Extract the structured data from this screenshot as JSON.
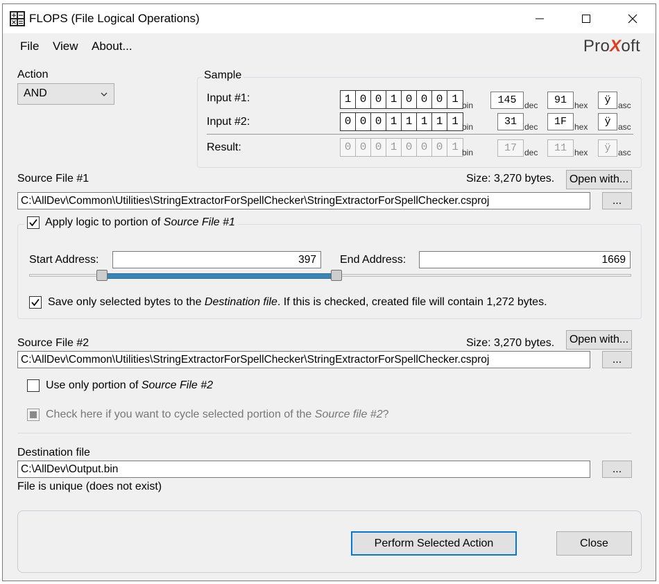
{
  "window": {
    "title": "FLOPS (File Logical Operations)",
    "icon": "calculator-icon"
  },
  "menu": {
    "items": [
      "File",
      "View",
      "About..."
    ]
  },
  "logo": {
    "pre": "Pro",
    "x": "X",
    "post": "oft"
  },
  "action": {
    "label": "Action",
    "selected": "AND"
  },
  "sample": {
    "legend": "Sample",
    "input1": {
      "label": "Input #1:",
      "bits": [
        "1",
        "0",
        "0",
        "1",
        "0",
        "0",
        "0",
        "1"
      ],
      "dec": "145",
      "hex": "91",
      "asc": "ÿ"
    },
    "input2": {
      "label": "Input #2:",
      "bits": [
        "0",
        "0",
        "0",
        "1",
        "1",
        "1",
        "1",
        "1"
      ],
      "dec": "31",
      "hex": "1F",
      "asc": "ÿ"
    },
    "result": {
      "label": "Result:",
      "bits": [
        "0",
        "0",
        "0",
        "1",
        "0",
        "0",
        "0",
        "1"
      ],
      "dec": "17",
      "hex": "11",
      "asc": "ÿ"
    },
    "suffix_bin": "bin",
    "suffix_dec": "dec",
    "suffix_hex": "hex",
    "suffix_asc": "asc"
  },
  "source1": {
    "label": "Source File #1",
    "size": "Size: 3,270 bytes.",
    "open_with": "Open with...",
    "path": "C:\\AllDev\\Common\\Utilities\\StringExtractorForSpellChecker\\StringExtractorForSpellChecker.csproj",
    "browse": "...",
    "portion_label_pre": "Apply logic to portion of ",
    "portion_label_em": "Source File #1",
    "start_label": "Start Address:",
    "start_value": "397",
    "end_label": "End Address:",
    "end_value": "1669",
    "range_start_fraction": 0.1214,
    "range_end_fraction": 0.5104,
    "save_pre": "Save only selected bytes to the ",
    "save_em": "Destination file",
    "save_post": ". If this is checked, created file will contain 1,272   bytes."
  },
  "source2": {
    "label": "Source File #2",
    "size": "Size: 3,270 bytes.",
    "open_with": "Open with...",
    "path": "C:\\AllDev\\Common\\Utilities\\StringExtractorForSpellChecker\\StringExtractorForSpellChecker.csproj",
    "browse": "...",
    "portion_pre": "Use only portion of ",
    "portion_em": "Source File #2",
    "cycle_pre": "Check here if you want to cycle selected portion of the ",
    "cycle_em": "Source file #2",
    "cycle_post": "?"
  },
  "destination": {
    "label": "Destination file",
    "path": "C:\\AllDev\\Output.bin",
    "browse": "...",
    "status": "File is unique (does not exist)"
  },
  "buttons": {
    "perform": "Perform Selected Action",
    "close": "Close"
  },
  "colors": {
    "accent": "#0078d7",
    "range_fill": "#3b84b7",
    "logo_x": "#e23b1a"
  }
}
